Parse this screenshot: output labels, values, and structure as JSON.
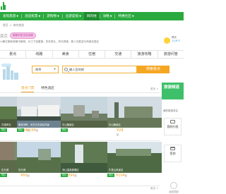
{
  "nav": {
    "items": [
      {
        "label": "发现旅游",
        "caret": true,
        "active": false
      },
      {
        "label": "酒店机票",
        "caret": true,
        "active": false
      },
      {
        "label": "游购物",
        "caret": true,
        "active": false
      },
      {
        "label": "出游度假",
        "caret": true,
        "active": false
      },
      {
        "label": "目的地",
        "caret": false,
        "active": true
      },
      {
        "label": "攻略",
        "caret": true,
        "active": false
      },
      {
        "label": "特惠社区",
        "caret": true,
        "active": false
      }
    ]
  },
  "breadcrumb": {
    "home": "首页",
    "sep": ">",
    "current": "南京旅游"
  },
  "city": {
    "name": "南京",
    "badge": "国家历史文化名城",
    "desc": "六朝古都和多朝代都城，长江下游重镇，历史悠久，风光秀美，数人文胜迹与风景名胜区"
  },
  "weather": {
    "label": "晴天",
    "temp": "11/9°C"
  },
  "categories": [
    "景点",
    "线路",
    "美食",
    "住宿",
    "交通",
    "旅游攻略",
    "旅游问答"
  ],
  "search": {
    "city_value": "南京",
    "placeholder": "输入目的地",
    "button": "搜索景点"
  },
  "tabs": {
    "items": [
      "景点门票",
      "特色酒店"
    ],
    "active": 0
  },
  "more_label": "更多 >",
  "cards": [
    {
      "caption": "古镇风光",
      "badge": "特价",
      "price": "¥84",
      "unit": "起"
    },
    {
      "caption": "秦淮河畔，历史文化街区风景",
      "badge": "特价",
      "price": "¥104",
      "unit": "起"
    },
    {
      "caption": "中山陵景区",
      "badge": "特价",
      "price": "¥28",
      "unit": "起"
    },
    {
      "caption": "石头城",
      "badge": "特价",
      "price": "¥60",
      "unit": "起"
    },
    {
      "caption": "汤山温泉度假区",
      "badge": "特价",
      "price": "¥90",
      "unit": "起"
    },
    {
      "caption": "牛首山风景区",
      "badge": "特价",
      "price": "¥104",
      "unit": "起"
    }
  ],
  "sidebar": {
    "promo": "旅游频道",
    "caption": "我的旅游关注",
    "boxes": [
      {
        "label": "我的行程",
        "icon": "suitcase-icon"
      },
      {
        "label": "签到",
        "icon": "calendar-icon"
      }
    ],
    "bottom": "返回顶部"
  },
  "colors": {
    "brand": "#2aaa3e",
    "accent": "#f5a623",
    "badge": "#f7c6ea"
  }
}
